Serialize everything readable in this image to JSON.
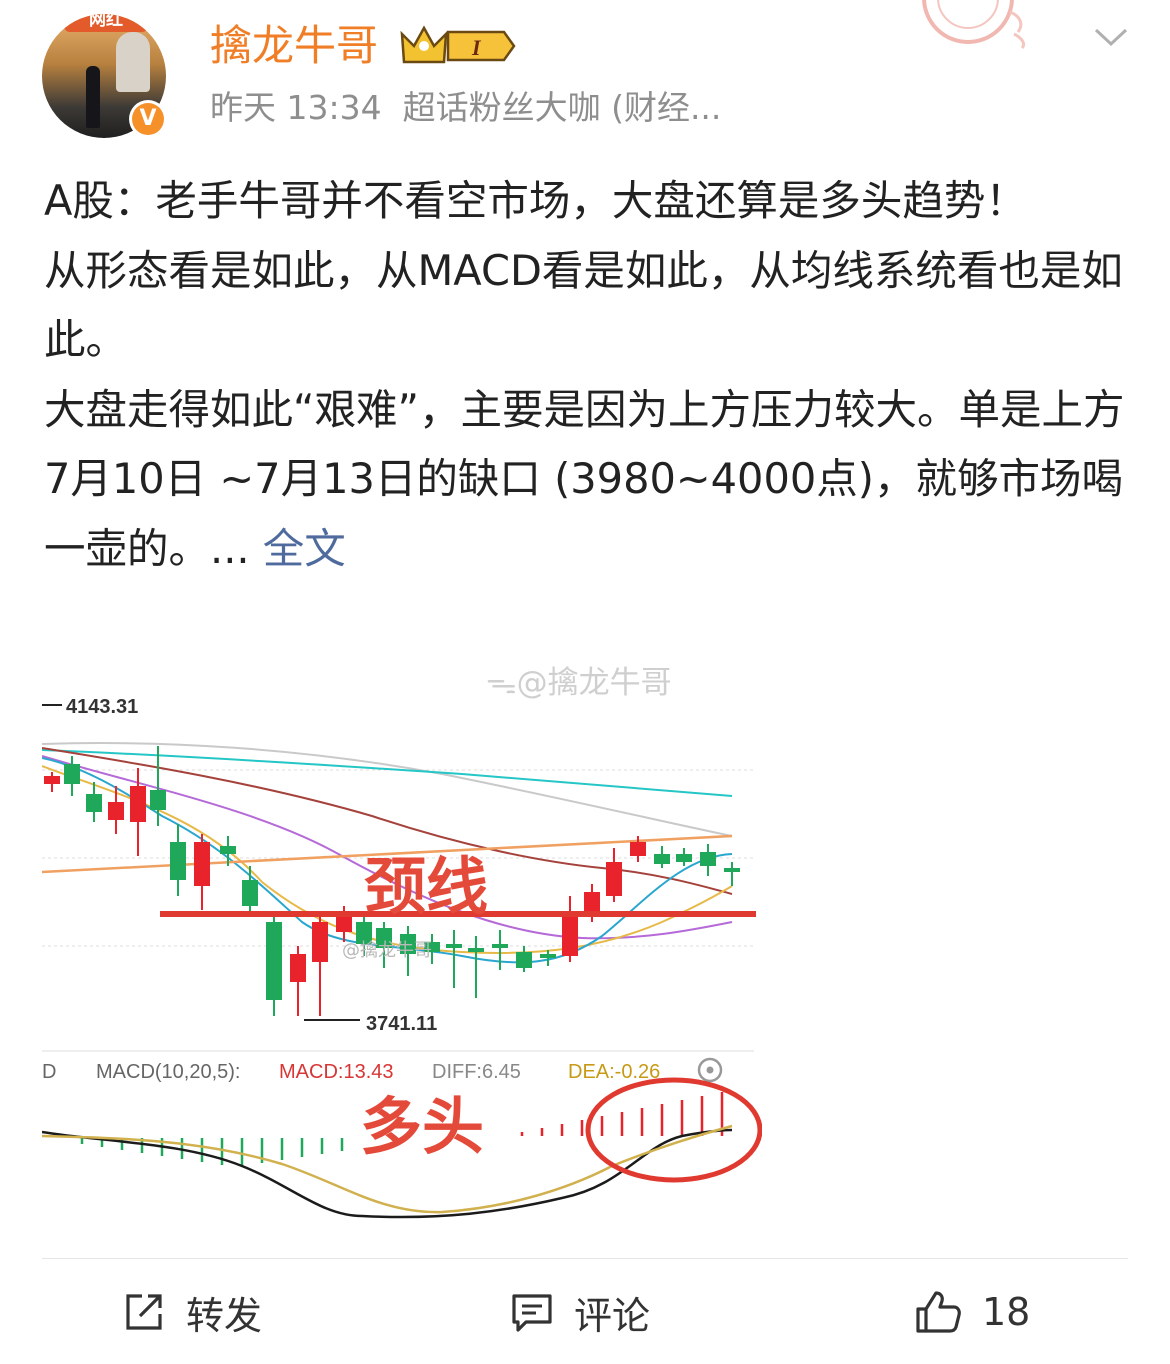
{
  "post": {
    "author": "擒龙牛哥",
    "avatar_tag": "网红",
    "verified_mark": "V",
    "level_badge": "I",
    "time": "昨天 13:34",
    "source": "超话粉丝大咖 (财经...",
    "paragraphs": [
      "A股：老手牛哥并不看空市场，大盘还算是多头趋势！",
      "从形态看是如此，从MACD看是如此，从均线系统看也是如此。",
      "大盘走得如此“艰难”，主要是因为上方压力较大。单是上方7月10日 ~7月13日的缺口 (3980~4000点)，就够市场喝一壶的。... "
    ],
    "more_link": "全文",
    "watermark": "@擒龙牛哥"
  },
  "chart": {
    "high_label": "4143.31",
    "low_label": "3741.11",
    "neckline_label": "颈线",
    "inner_watermark": "@擒龙牛哥",
    "macd_title": "MACD(10,20,5):",
    "macd_value": "MACD:13.43",
    "diff_value": "DIFF:6.45",
    "dea_value": "DEA:-0.26",
    "bull_label": "多头",
    "colors": {
      "up": "#e8232b",
      "down": "#1fa85a",
      "neckline": "#e03a30",
      "ma_cyan": "#25c6c6",
      "ma_gray": "#c9c9c9",
      "ma_orange": "#f0a060",
      "ma_purple": "#b56ad8"
    }
  },
  "actions": {
    "forward": "转发",
    "comment": "评论",
    "like_count": "18"
  },
  "icons": {
    "forward": "share-edit-icon",
    "comment": "comment-icon",
    "like": "thumbs-up-icon",
    "more": "chevron-down-icon",
    "crown": "crown-icon",
    "stamp": "stamp-icon"
  }
}
